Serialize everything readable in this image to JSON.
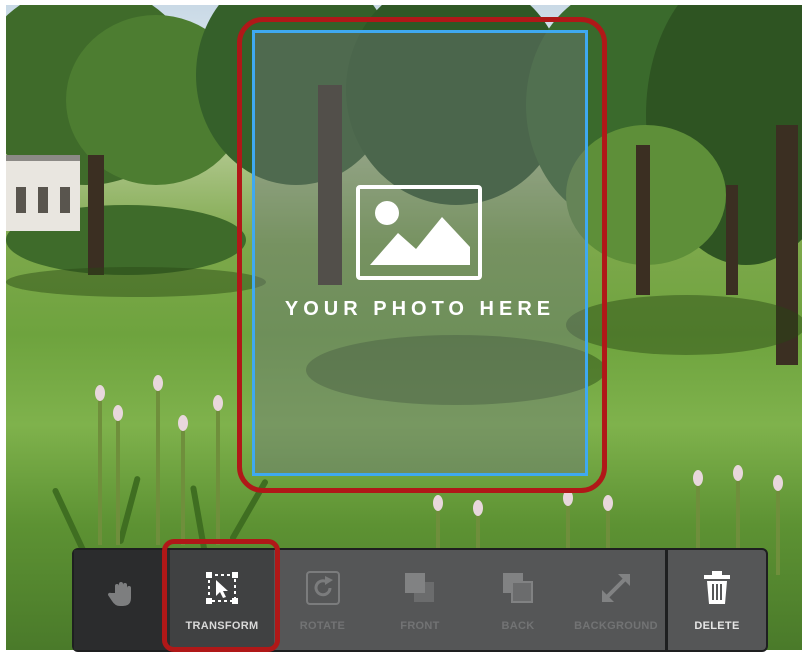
{
  "placeholder": {
    "text": "YOUR PHOTO HERE",
    "icon": "image-icon"
  },
  "toolbar": {
    "tools": [
      {
        "id": "pan",
        "label": "",
        "icon": "hand-icon",
        "state": "normal"
      },
      {
        "id": "transform",
        "label": "TRANSFORM",
        "icon": "transform-icon",
        "state": "active"
      },
      {
        "id": "rotate",
        "label": "ROTATE",
        "icon": "rotate-icon",
        "state": "disabled"
      },
      {
        "id": "front",
        "label": "FRONT",
        "icon": "bring-front-icon",
        "state": "disabled"
      },
      {
        "id": "back",
        "label": "BACK",
        "icon": "send-back-icon",
        "state": "disabled"
      },
      {
        "id": "background",
        "label": "BACKGROUND",
        "icon": "background-expand-icon",
        "state": "disabled"
      },
      {
        "id": "delete",
        "label": "DELETE",
        "icon": "trash-icon",
        "state": "normal"
      }
    ]
  },
  "colors": {
    "highlight": "#b01818",
    "frame": "#3fa9f0",
    "toolbar": "#555657"
  }
}
